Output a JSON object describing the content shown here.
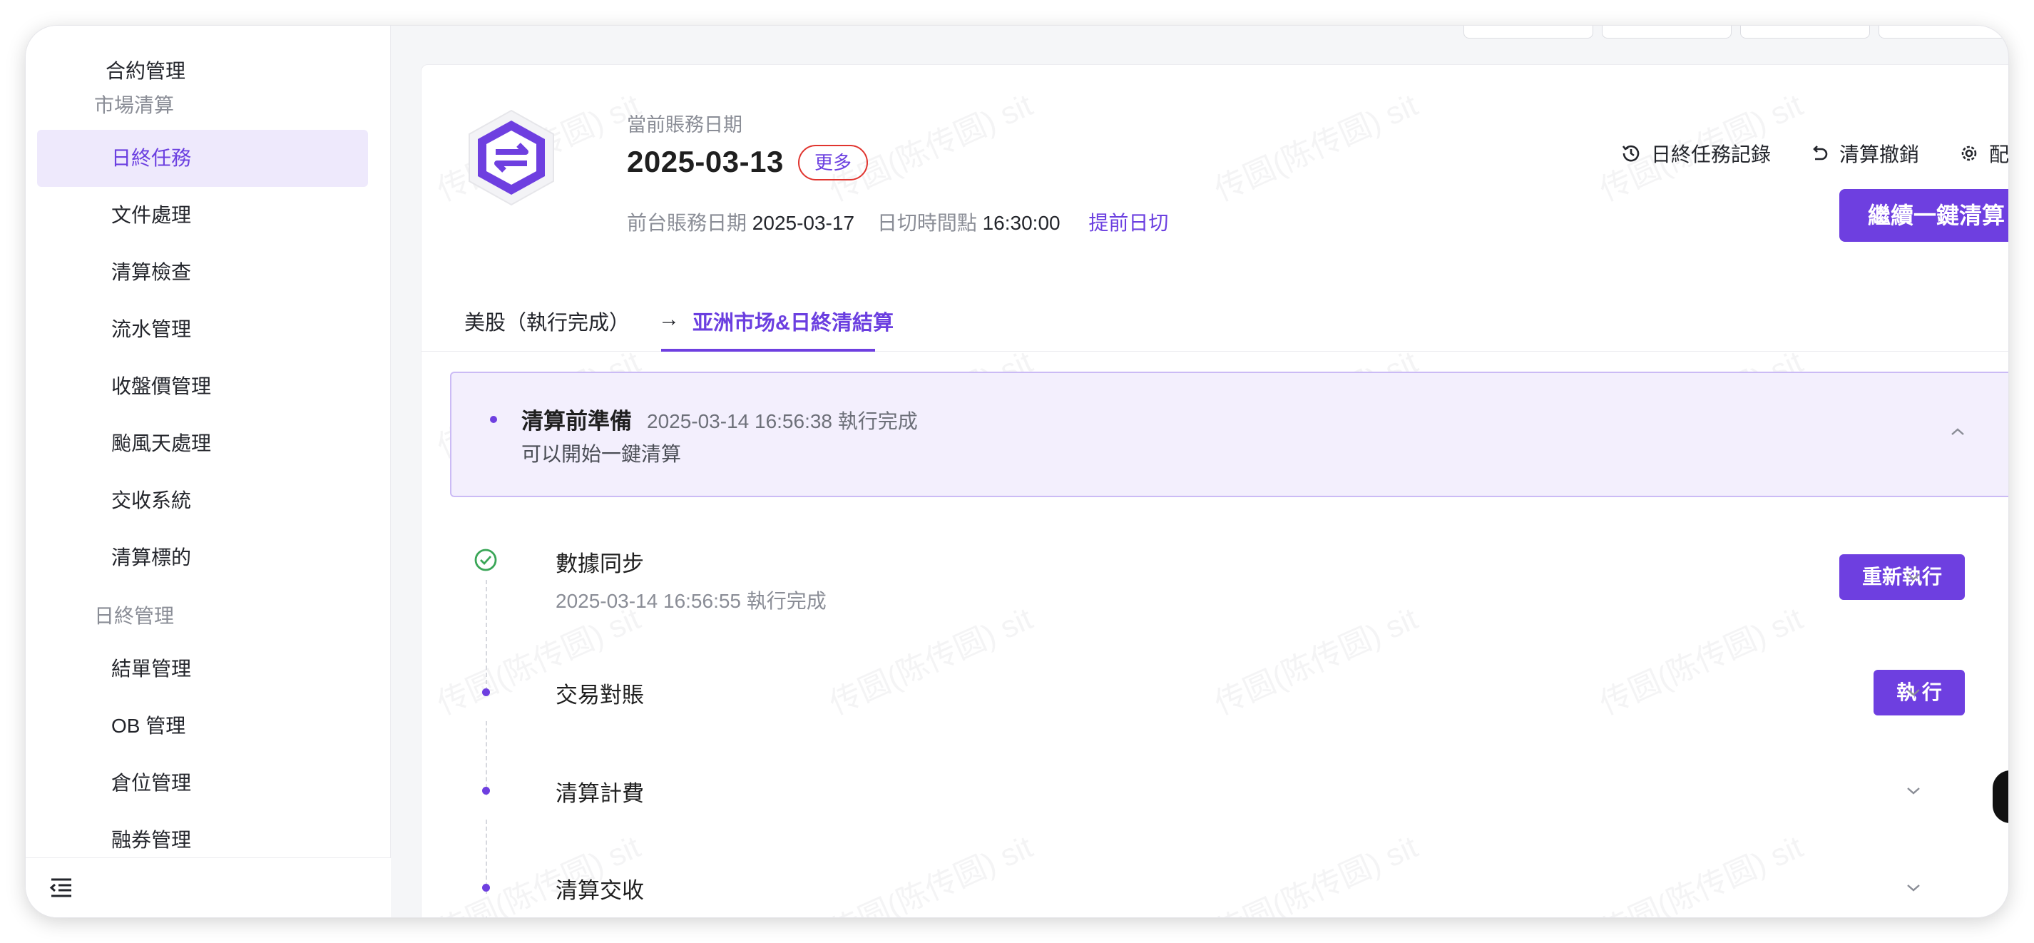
{
  "sidebar": {
    "top_item": "合約管理",
    "group_market": "市場清算",
    "market_items": [
      "日終任務",
      "文件處理",
      "清算檢查",
      "流水管理",
      "收盤價管理",
      "颱風天處理",
      "交收系統",
      "清算標的"
    ],
    "group_eod": "日終管理",
    "eod_items": [
      "結單管理",
      "OB 管理",
      "倉位管理",
      "融券管理"
    ],
    "active_item": "日終任務"
  },
  "header": {
    "date_label": "當前賬務日期",
    "current_date": "2025-03-13",
    "more_label": "更多",
    "front_date_label": "前台賬務日期",
    "front_date": "2025-03-17",
    "cutoff_label": "日切時間點",
    "cutoff_time": "16:30:00",
    "advance_cutoff": "提前日切",
    "actions": {
      "history": "日終任務記錄",
      "revoke": "清算撤銷",
      "config": "配置"
    },
    "continue_button": "繼續一鍵清算"
  },
  "tabs": {
    "us": "美股（執行完成）",
    "arrow": "→",
    "asia": "亚洲市场&日終清結算"
  },
  "pre_settlement": {
    "title": "清算前準備",
    "meta": "2025-03-14 16:56:38 執行完成",
    "desc": "可以開始一鍵清算"
  },
  "steps": [
    {
      "title": "數據同步",
      "meta": "2025-03-14 16:56:55   執行完成",
      "button": "重新執行",
      "status": "done"
    },
    {
      "title": "交易對賬",
      "button": "執 行",
      "status": "pending"
    },
    {
      "title": "清算計費",
      "status": "pending"
    },
    {
      "title": "清算交收",
      "status": "pending"
    }
  ],
  "watermark_text": "传圆(陈传圆) sit",
  "colors": {
    "accent": "#6e3fe0",
    "active_bg": "#eee9fc",
    "success": "#3aa657",
    "highlight_border": "#e0342e"
  }
}
